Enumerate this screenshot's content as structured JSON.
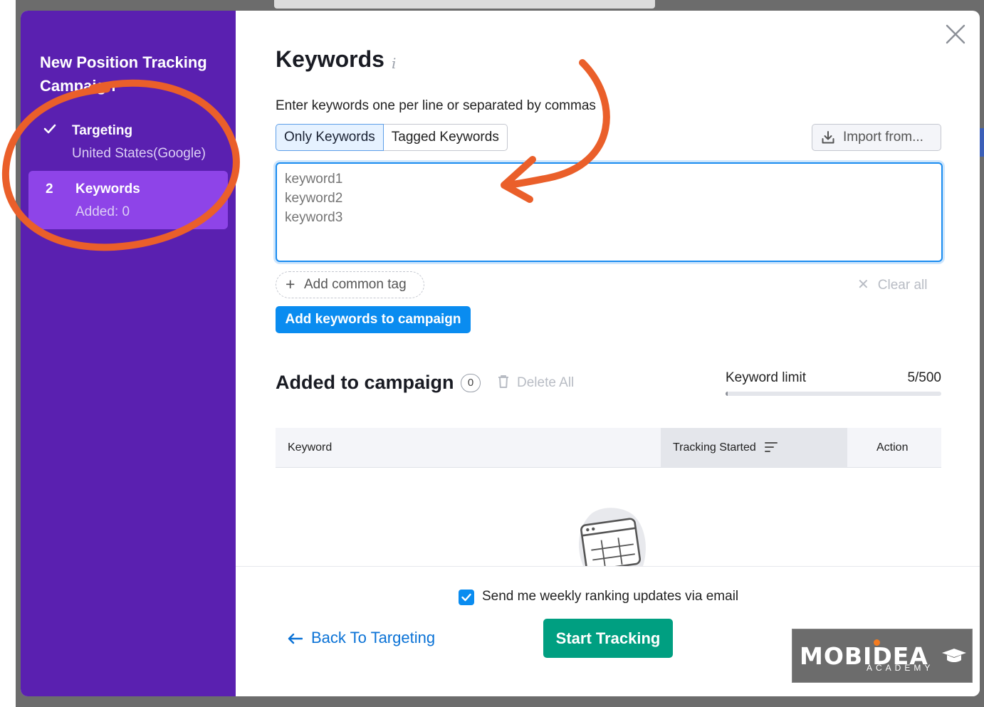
{
  "sidebar": {
    "title": "New Position Tracking Campaign",
    "steps": [
      {
        "title": "Targeting",
        "subtitle": "United States(Google)",
        "status": "done"
      },
      {
        "number": "2",
        "title": "Keywords",
        "subtitle": "Added: 0",
        "status": "active"
      }
    ]
  },
  "keywords": {
    "heading": "Keywords",
    "info_icon": "i",
    "instructions": "Enter keywords one per line or separated by commas",
    "tabs": [
      "Only Keywords",
      "Tagged Keywords"
    ],
    "active_tab": "Only Keywords",
    "import_label": "Import from...",
    "textarea_placeholder": "keyword1\nkeyword2\nkeyword3",
    "add_tag_label": "Add common tag",
    "clear_all_label": "Clear all",
    "add_button_label": "Add keywords to campaign"
  },
  "campaign": {
    "heading": "Added to campaign",
    "count": "0",
    "delete_all_label": "Delete All",
    "limit_label": "Keyword limit",
    "limit_value": "5/500",
    "limit_fraction": 0.01,
    "columns": [
      "Keyword",
      "Tracking Started",
      "Action"
    ]
  },
  "footer": {
    "email_updates_label": "Send me weekly ranking updates via email",
    "email_updates_checked": true,
    "back_label": "Back To Targeting",
    "start_label": "Start Tracking"
  },
  "watermark": {
    "main": "MOBIDEA",
    "sub": "ACADEMY"
  },
  "colors": {
    "sidebar_bg": "#5a20b0",
    "active_step_bg": "#8e44e8",
    "primary_blue": "#0a8cf0",
    "start_green": "#009f81",
    "annotation_orange": "#ea5f2a"
  }
}
